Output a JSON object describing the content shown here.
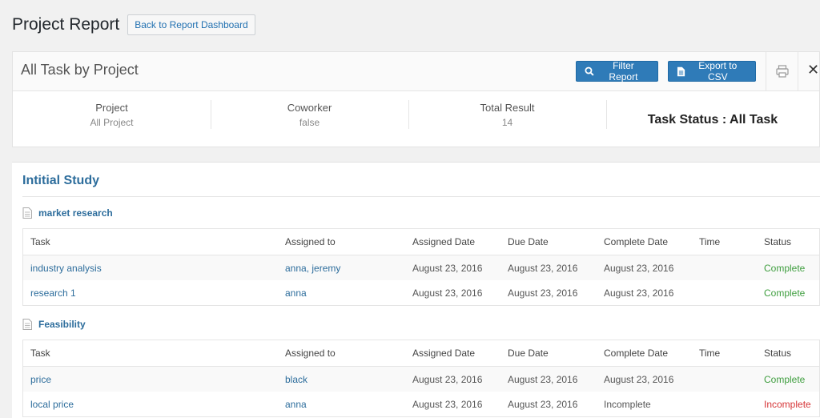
{
  "page": {
    "title": "Project Report",
    "back_button": "Back to Report Dashboard"
  },
  "report": {
    "title": "All Task by Project",
    "filter_button": "Filter Report",
    "export_button": "Export to CSV",
    "close_glyph": "✕",
    "icons": {
      "filter": "search-icon",
      "export": "document-icon",
      "print": "print-icon",
      "close": "close-icon"
    },
    "summary": {
      "project": {
        "label": "Project",
        "value": "All Project"
      },
      "coworker": {
        "label": "Coworker",
        "value": "false"
      },
      "total": {
        "label": "Total Result",
        "value": "14"
      },
      "task_status": "Task Status : All Task"
    }
  },
  "project": {
    "name": "Intitial Study",
    "columns": [
      "Task",
      "Assigned to",
      "Assigned Date",
      "Due Date",
      "Complete Date",
      "Time",
      "Status"
    ],
    "groups": [
      {
        "name": "market research",
        "rows": [
          {
            "task": "industry analysis",
            "assigned": "anna, jeremy",
            "assigned_date": "August 23, 2016",
            "due_date": "August 23, 2016",
            "complete_date": "August 23, 2016",
            "time": "",
            "status": "Complete"
          },
          {
            "task": "research 1",
            "assigned": "anna",
            "assigned_date": "August 23, 2016",
            "due_date": "August 23, 2016",
            "complete_date": "August 23, 2016",
            "time": "",
            "status": "Complete"
          }
        ]
      },
      {
        "name": "Feasibility",
        "rows": [
          {
            "task": "price",
            "assigned": "black",
            "assigned_date": "August 23, 2016",
            "due_date": "August 23, 2016",
            "complete_date": "August 23, 2016",
            "time": "",
            "status": "Complete"
          },
          {
            "task": "local price",
            "assigned": "anna",
            "assigned_date": "August 23, 2016",
            "due_date": "August 23, 2016",
            "complete_date": "Incomplete",
            "time": "",
            "status": "Incomplete"
          }
        ]
      }
    ]
  },
  "colors": {
    "link": "#2d6d9c",
    "button": "#2f7bb8",
    "complete": "#3f9e3f",
    "incomplete": "#d63638"
  }
}
